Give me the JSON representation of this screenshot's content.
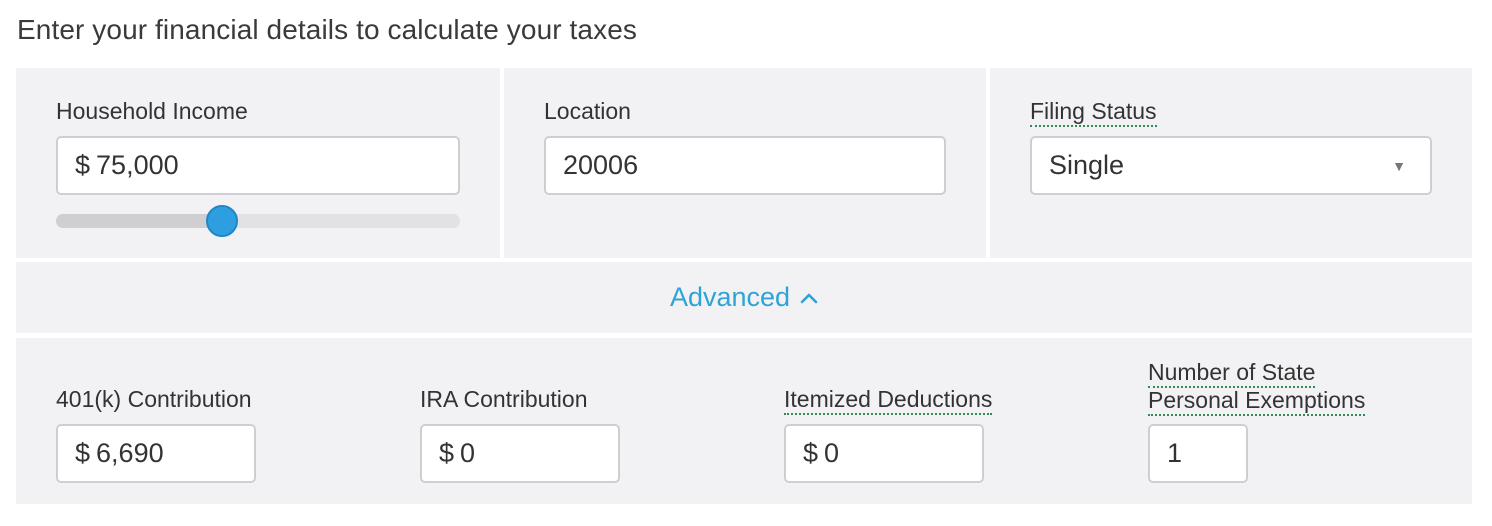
{
  "heading": "Enter your financial details to calculate your taxes",
  "income": {
    "label": "Household Income",
    "currency": "$",
    "value": "75,000",
    "slider_fraction": 0.41
  },
  "location": {
    "label": "Location",
    "value": "20006"
  },
  "filing": {
    "label": "Filing Status",
    "value": "Single",
    "caret_icon": "triangle-down-icon"
  },
  "advanced": {
    "label": "Advanced",
    "icon": "chevron-up-icon",
    "color": "#2ea3d7"
  },
  "extra": {
    "k401": {
      "label": "401(k) Contribution",
      "currency": "$",
      "value": "6,690"
    },
    "ira": {
      "label": "IRA Contribution",
      "currency": "$",
      "value": "0"
    },
    "itemized": {
      "label": "Itemized Deductions",
      "currency": "$",
      "value": "0"
    },
    "exemptions": {
      "label_line1": "Number of State",
      "label_line2": "Personal Exemptions",
      "value": "1"
    }
  },
  "colors": {
    "accent": "#2ea3d7",
    "slider_thumb": "#2d9fe0",
    "panel_bg": "#f2f2f4",
    "dotted_underline": "#2e8b57"
  }
}
